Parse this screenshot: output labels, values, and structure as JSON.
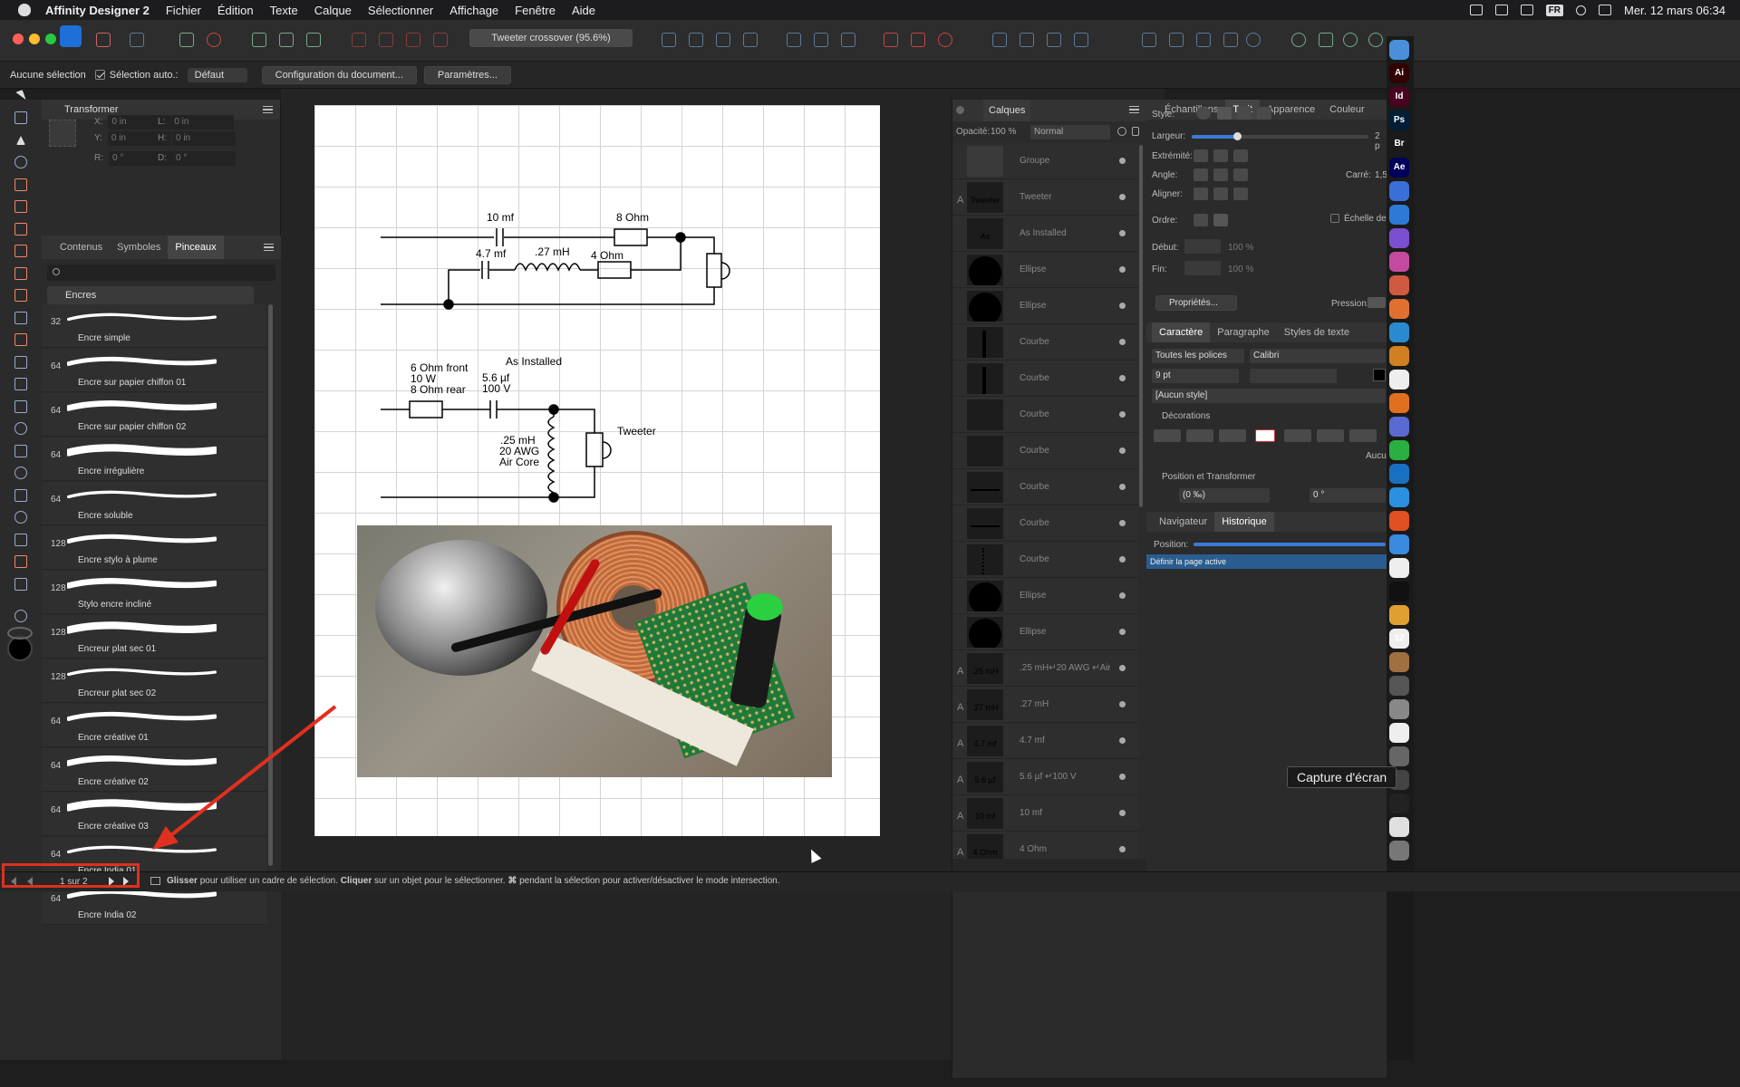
{
  "menubar": {
    "app": "Affinity Designer 2",
    "items": [
      "Fichier",
      "Édition",
      "Texte",
      "Calque",
      "Sélectionner",
      "Affichage",
      "Fenêtre",
      "Aide"
    ],
    "lang": "FR",
    "clock": "Mer. 12 mars  06:34"
  },
  "toolbar": {
    "doc_title": "Tweeter crossover (95.6%)"
  },
  "context": {
    "no_selection": "Aucune sélection",
    "auto_select": "Sélection auto.:",
    "mode": "Défaut",
    "doc_config": "Configuration du document...",
    "params": "Paramètres..."
  },
  "transform": {
    "title": "Transformer",
    "x_label": "X:",
    "x": "0 in",
    "y_label": "Y:",
    "y": "0 in",
    "l_label": "L:",
    "l": "0 in",
    "h_label": "H:",
    "h": "0 in",
    "r_label": "R:",
    "r": "0 °",
    "d_label": "D:",
    "d": "0 °"
  },
  "brushes": {
    "tabs": [
      "Contenus",
      "Symboles",
      "Pinceaux"
    ],
    "category": "Encres",
    "items": [
      {
        "size": "32",
        "name": "Encre simple"
      },
      {
        "size": "64",
        "name": "Encre sur papier chiffon 01"
      },
      {
        "size": "64",
        "name": "Encre sur papier chiffon 02"
      },
      {
        "size": "64",
        "name": "Encre irrégulière"
      },
      {
        "size": "64",
        "name": "Encre soluble"
      },
      {
        "size": "128",
        "name": "Encre stylo à plume"
      },
      {
        "size": "128",
        "name": "Stylo encre incliné"
      },
      {
        "size": "128",
        "name": "Encreur plat sec 01"
      },
      {
        "size": "128",
        "name": "Encreur plat sec 02"
      },
      {
        "size": "64",
        "name": "Encre créative 01"
      },
      {
        "size": "64",
        "name": "Encre créative 02"
      },
      {
        "size": "64",
        "name": "Encre créative 03"
      },
      {
        "size": "64",
        "name": "Encre India 01"
      },
      {
        "size": "64",
        "name": "Encre India 02"
      }
    ]
  },
  "schematic": {
    "c1": "10 mf",
    "r1": "8 Ohm",
    "c2": "4.7 mf",
    "l1": ".27 mH",
    "r2": "4 Ohm",
    "installed_title": "As Installed",
    "r3_line1": "6 Ohm front",
    "r3_line2": "10 W",
    "r3_line3": "8 Ohm rear",
    "c3_line1": "5.6 µf",
    "c3_line2": "100 V",
    "l2_line1": ".25 mH",
    "l2_line2": "20 AWG",
    "l2_line3": "Air Core",
    "tweeter": "Tweeter"
  },
  "layers": {
    "title": "Calques",
    "opacity_label": "Opacité:",
    "opacity": "100 %",
    "blend": "Normal",
    "rows": [
      {
        "type": "",
        "name": "Groupe",
        "thumb": "group"
      },
      {
        "type": "A",
        "name": "Tweeter",
        "thumb": "Tweeter"
      },
      {
        "type": "",
        "name": "As Installed",
        "thumb": "As Installed"
      },
      {
        "type": "",
        "name": "Ellipse",
        "thumb": "ellipse"
      },
      {
        "type": "",
        "name": "Ellipse",
        "thumb": "ellipse"
      },
      {
        "type": "",
        "name": "Courbe",
        "thumb": "vline"
      },
      {
        "type": "",
        "name": "Courbe",
        "thumb": "vline"
      },
      {
        "type": "",
        "name": "Courbe",
        "thumb": "none"
      },
      {
        "type": "",
        "name": "Courbe",
        "thumb": "none"
      },
      {
        "type": "",
        "name": "Courbe",
        "thumb": "hline"
      },
      {
        "type": "",
        "name": "Courbe",
        "thumb": "hline"
      },
      {
        "type": "",
        "name": "Courbe",
        "thumb": "coil"
      },
      {
        "type": "",
        "name": "Ellipse",
        "thumb": "ellipse"
      },
      {
        "type": "",
        "name": "Ellipse",
        "thumb": "ellipse"
      },
      {
        "type": "A",
        "name": ".25 mH↵20 AWG ↵Air...",
        "thumb": ".25 mH 20 AWG Air Core"
      },
      {
        "type": "A",
        "name": ".27 mH",
        "thumb": ".27 mH"
      },
      {
        "type": "A",
        "name": "4.7 mf",
        "thumb": "4.7 mf"
      },
      {
        "type": "A",
        "name": "5.6 µf ↵100 V",
        "thumb": "5.6 µf 100 V"
      },
      {
        "type": "A",
        "name": "10 mf",
        "thumb": "10 mf"
      },
      {
        "type": "A",
        "name": "4 Ohm",
        "thumb": "4 Ohm"
      }
    ]
  },
  "stroke": {
    "tabs": [
      "Échantillons",
      "Trait",
      "Apparence",
      "Couleur"
    ],
    "style_label": "Style:",
    "width_label": "Largeur:",
    "width_value": "2 p",
    "cap_label": "Extrémité:",
    "angle_label": "Angle:",
    "align_label": "Aligner:",
    "square_label": "Carré:",
    "square_value": "1,5",
    "order_label": "Ordre:",
    "scale_label": "Échelle de l'o",
    "start_label": "Début:",
    "start_value": "100 %",
    "end_label": "Fin:",
    "end_value": "100 %",
    "props_button": "Propriétés...",
    "pressure_label": "Pression:"
  },
  "character": {
    "tabs": [
      "Caractère",
      "Paragraphe",
      "Styles de texte"
    ],
    "font_collection": "Toutes les polices",
    "font": "Calibri",
    "size": "9 pt",
    "style": "[Aucun style]",
    "decorations_label": "Décorations",
    "none_label": "Aucun",
    "pos_label": "Position et Transformer",
    "tracking": "(0 ‰)",
    "skew": "0 °"
  },
  "history": {
    "tabs": [
      "Navigateur",
      "Historique"
    ],
    "position_label": "Position:",
    "entry": "Définir la page active"
  },
  "dock": {
    "items": [
      {
        "label": "",
        "color": "#4a8fd8"
      },
      {
        "label": "Ai",
        "color": "#330000"
      },
      {
        "label": "Id",
        "color": "#49021f"
      },
      {
        "label": "Ps",
        "color": "#001e36"
      },
      {
        "label": "Br",
        "color": "#1a1a1a"
      },
      {
        "label": "Ae",
        "color": "#00005b"
      },
      {
        "label": "",
        "color": "#3a6fd8"
      },
      {
        "label": "",
        "color": "#2d7ad6"
      },
      {
        "label": "",
        "color": "#7a4fd0"
      },
      {
        "label": "",
        "color": "#c44aa0"
      },
      {
        "label": "",
        "color": "#d05a40"
      },
      {
        "label": "",
        "color": "#e07030"
      },
      {
        "label": "",
        "color": "#2a8ad0"
      },
      {
        "label": "",
        "color": "#d08020"
      },
      {
        "label": "",
        "color": "#eeeeee"
      },
      {
        "label": "",
        "color": "#e07020"
      },
      {
        "label": "",
        "color": "#5a6ad0"
      },
      {
        "label": "",
        "color": "#2ab040"
      },
      {
        "label": "",
        "color": "#1a70c0"
      },
      {
        "label": "",
        "color": "#2a90e0"
      },
      {
        "label": "",
        "color": "#e05020"
      },
      {
        "label": "",
        "color": "#3a8ae0"
      },
      {
        "label": "",
        "color": "#eeeeee"
      },
      {
        "label": "",
        "color": "#111111"
      },
      {
        "label": "",
        "color": "#e0a030"
      },
      {
        "label": "12",
        "color": "#eeeeee"
      },
      {
        "label": "",
        "color": "#a07040"
      },
      {
        "label": "",
        "color": "#555555"
      },
      {
        "label": "",
        "color": "#888888"
      },
      {
        "label": "",
        "color": "#eeeeee"
      },
      {
        "label": "",
        "color": "#666666"
      },
      {
        "label": "",
        "color": "#444444"
      },
      {
        "label": "",
        "color": "#222222"
      },
      {
        "label": "",
        "color": "#e0e0e0"
      },
      {
        "label": "",
        "color": "#777777"
      }
    ]
  },
  "status": {
    "page": "1 sur 2",
    "hint_b1": "Glisser",
    "hint_t1": " pour utiliser un cadre de sélection. ",
    "hint_b2": "Cliquer",
    "hint_t2": " sur un objet pour le sélectionner. ",
    "hint_b3": "⌘",
    "hint_t3": " pendant la sélection pour activer/désactiver le mode intersection."
  },
  "tooltip": "Capture d'écran",
  "colors": {
    "accent": "#2d5a8a",
    "highlight": "#e0301e",
    "selected_row": "#2a5d8f"
  }
}
